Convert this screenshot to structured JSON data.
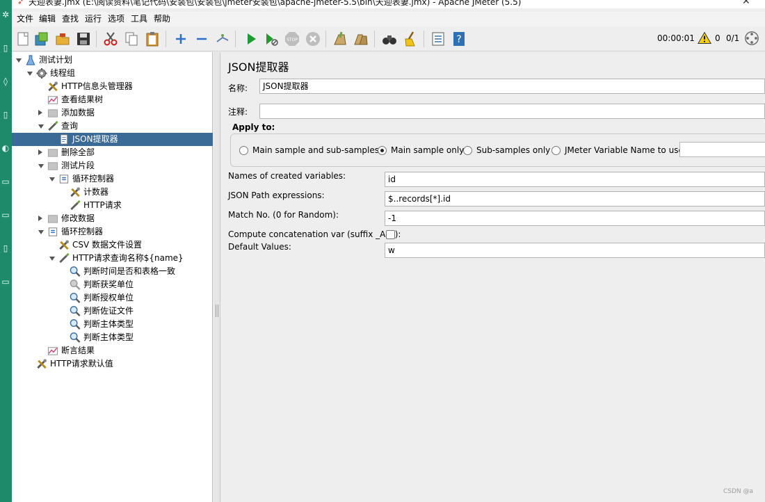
{
  "window": {
    "title": "天迎表妻.jmx (E:\\阅读资料\\笔记代码\\安装包\\安装包\\jmeter安装包\\apache-jmeter-5.5\\bin\\天迎表妻.jmx) - Apache JMeter (5.5)"
  },
  "menu": {
    "items": [
      "文件",
      "编辑",
      "查找",
      "运行",
      "选项",
      "工具",
      "帮助"
    ]
  },
  "toolbar": {
    "elapsed_time": "00:00:01",
    "warning_count": "0",
    "thread_ratio": "0/1"
  },
  "tree": {
    "nodes": [
      {
        "label": "测试计划",
        "icon": "test-plan-icon"
      },
      {
        "label": "线程组",
        "icon": "thread-group-gear-icon"
      },
      {
        "label": "HTTP信息头管理器",
        "icon": "config-tools-icon"
      },
      {
        "label": "查看结果树",
        "icon": "listener-graph-icon"
      },
      {
        "label": "添加数据",
        "icon": "disabled-sampler-icon"
      },
      {
        "label": "查询",
        "icon": "sampler-pipette-icon"
      },
      {
        "label": "JSON提取器",
        "icon": "extractor-document-icon"
      },
      {
        "label": "删除全部",
        "icon": "disabled-sampler-icon"
      },
      {
        "label": "测试片段",
        "icon": "disabled-sampler-icon"
      },
      {
        "label": "循环控制器",
        "icon": "loop-controller-icon"
      },
      {
        "label": "计数器",
        "icon": "config-tools-icon"
      },
      {
        "label": "HTTP请求",
        "icon": "sampler-pipette-icon"
      },
      {
        "label": "修改数据",
        "icon": "disabled-sampler-icon"
      },
      {
        "label": "循环控制器",
        "icon": "loop-controller-icon"
      },
      {
        "label": "CSV 数据文件设置",
        "icon": "config-tools-icon"
      },
      {
        "label": "HTTP请求查询名称${name}",
        "icon": "sampler-pipette-icon"
      },
      {
        "label": "判断时间是否和表格一致",
        "icon": "assertion-magnifier-icon"
      },
      {
        "label": "判断获奖单位",
        "icon": "assertion-magnifier-disabled-icon"
      },
      {
        "label": "判断授权单位",
        "icon": "assertion-magnifier-icon"
      },
      {
        "label": "判断佐证文件",
        "icon": "assertion-magnifier-icon"
      },
      {
        "label": "判断主体类型",
        "icon": "assertion-magnifier-icon"
      },
      {
        "label": "判断主体类型",
        "icon": "assertion-magnifier-icon"
      },
      {
        "label": "断言结果",
        "icon": "listener-graph-icon"
      },
      {
        "label": "HTTP请求默认值",
        "icon": "config-tools-icon"
      }
    ]
  },
  "editor": {
    "title": "JSON提取器",
    "name_label": "名称:",
    "name_value": "JSON提取器",
    "comment_label": "注释:",
    "comment_value": "",
    "apply_to": {
      "label": "Apply to:",
      "options": [
        "Main sample and sub-samples",
        "Main sample only",
        "Sub-samples only",
        "JMeter Variable Name to use"
      ],
      "selected": "Main sample only",
      "variable_name_value": ""
    },
    "created_variables_label": "Names of created variables:",
    "created_variables_value": "id",
    "json_path_label": "JSON Path expressions:",
    "json_path_value": "$..records[*].id",
    "match_no_label": "Match No. (0 for Random):",
    "match_no_value": "-1",
    "concat_label": "Compute concatenation var (suffix _ALL):",
    "concat_checked": false,
    "default_values_label": "Default Values:",
    "default_values_value": "w"
  },
  "watermark": "CSDN @a",
  "colors": {
    "selection": "#3a6a96",
    "background": "#eeeeee",
    "desktop": "#2f8f73"
  }
}
